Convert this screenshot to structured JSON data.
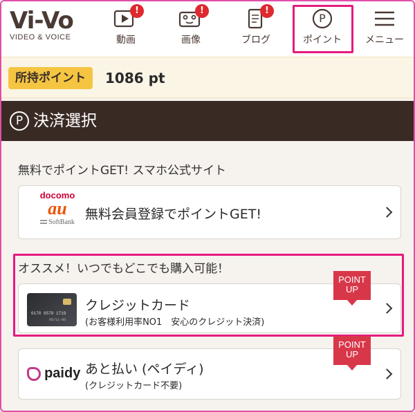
{
  "logo": {
    "main": "Vi-Vo",
    "sub": "VIDEO & VOICE"
  },
  "nav": [
    {
      "label": "動画",
      "badge": "!"
    },
    {
      "label": "画像",
      "badge": "!"
    },
    {
      "label": "ブログ",
      "badge": "!"
    },
    {
      "label": "ポイント",
      "icon_glyph": "P"
    },
    {
      "label": "メニュー"
    }
  ],
  "points": {
    "label": "所持ポイント",
    "value": "1086 pt"
  },
  "section": {
    "icon_glyph": "P",
    "title": "決済選択"
  },
  "free_section": {
    "heading": "無料でポイントGET! スマホ公式サイト",
    "carrier_logos": [
      "docomo",
      "au",
      "SoftBank"
    ],
    "card_title": "無料会員登録でポイントGET!"
  },
  "recommend": {
    "heading": "オススメ！いつでもどこでも購入可能！",
    "credit": {
      "title": "クレジットカード",
      "sub": "(お客様利用率NO1　安心のクレジット決済)",
      "ribbon": [
        "POINT",
        "UP"
      ],
      "card_number": "0170 6579 1719",
      "card_expiry": "05/11-06"
    }
  },
  "paidy": {
    "logo_text": "paidy",
    "title": "あと払い (ペイディ)",
    "sub": "(クレジットカード不要)",
    "ribbon": [
      "POINT",
      "UP"
    ]
  },
  "colors": {
    "highlight": "#e6197f",
    "section_bg": "#3a2a24",
    "points_label_bg": "#f5c542",
    "badge": "#e0282f",
    "ribbon": "#d8374a",
    "docomo": "#cc0033",
    "au": "#eb5505"
  }
}
